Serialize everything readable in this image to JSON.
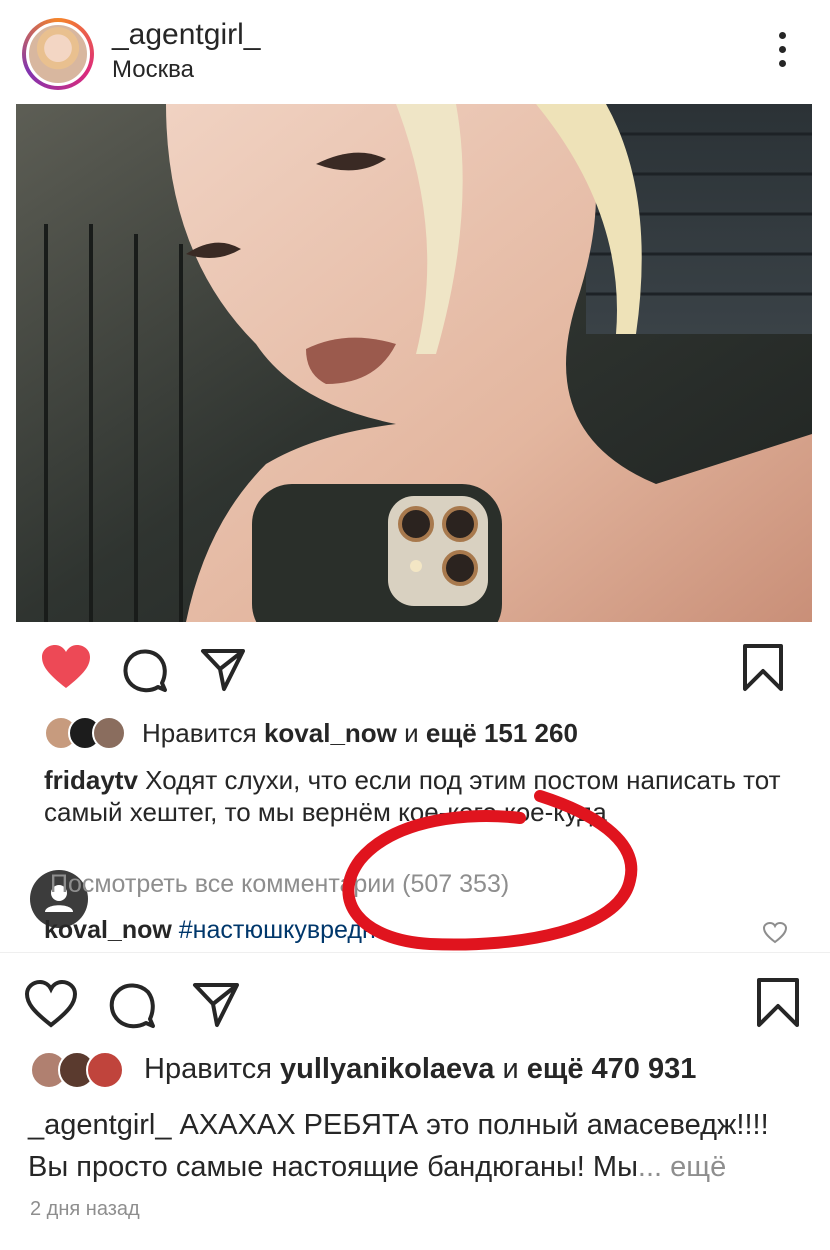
{
  "post": {
    "username": "_agentgirl_",
    "location": "Москва"
  },
  "feed_post": {
    "likes": {
      "prefix": "Нравится ",
      "user": "koval_now",
      "middle": " и ",
      "count": "ещё 151 260"
    },
    "caption": {
      "user": "fridaytv",
      "text": " Ходят слухи, что если под этим постом написать тот самый хештег, то мы вернём кое-кого кое-куда"
    },
    "view_all": "Посмотреть все комментарии (507 353)",
    "comment": {
      "user": "koval_now",
      "tag": " #настюшкувредн..."
    }
  },
  "main_post": {
    "likes": {
      "prefix": "Нравится ",
      "user": "yullyanikolaeva",
      "middle": " и ",
      "count": "ещё 470 931"
    },
    "caption": {
      "user": "_agentgirl_",
      "text": " АХАХАХ РЕБЯТА это полный амасеведж!!!! Вы просто самые настоящие бандюганы! Мы",
      "ellipsis": "...",
      "more": " ещё"
    },
    "timestamp": "2 дня назад"
  },
  "colors": {
    "like_red": "#ed4956",
    "annotation_red": "#e0141e",
    "text": "#262626",
    "muted": "#8e8e8e",
    "hashtag": "#00376b"
  },
  "icons": [
    "more-vertical-icon",
    "heart-icon",
    "comment-icon",
    "share-icon",
    "bookmark-icon",
    "user-icon"
  ]
}
